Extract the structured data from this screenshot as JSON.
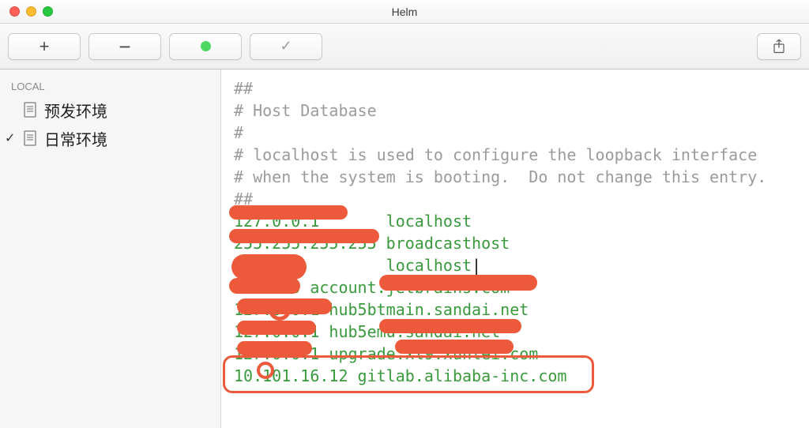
{
  "window": {
    "title": "Helm"
  },
  "toolbar": {
    "add_label": "+",
    "remove_label": "−",
    "check_label": "✓"
  },
  "sidebar": {
    "section_label": "LOCAL",
    "items": [
      {
        "label": "预发环境",
        "selected": false
      },
      {
        "label": "日常环境",
        "selected": true
      }
    ]
  },
  "editor": {
    "lines": [
      {
        "text": "##",
        "cls": "comment"
      },
      {
        "text": "# Host Database",
        "cls": "comment"
      },
      {
        "text": "#",
        "cls": "comment"
      },
      {
        "text": "# localhost is used to configure the loopback interface",
        "cls": "comment"
      },
      {
        "text": "# when the system is booting.  Do not change this entry.",
        "cls": "comment"
      },
      {
        "text": "##",
        "cls": "comment"
      },
      {
        "text": "127.0.0.1       localhost",
        "cls": "ip-green"
      },
      {
        "text": "255.255.255.255 broadcasthost",
        "cls": "ip-green"
      },
      {
        "text": "::1             localhost",
        "cls": "ip-green cursor-line"
      },
      {
        "text": "0.0.0.0 account.jetbrains.com",
        "cls": "ip-green"
      },
      {
        "text": "127.0.0.1 hub5btmain.sandai.net",
        "cls": "ip-green"
      },
      {
        "text": "127.0.0.1 hub5emu.sandai.net",
        "cls": "ip-green"
      },
      {
        "text": "127.0.0.1 upgrade.xl9.xunlei.com",
        "cls": "ip-green"
      },
      {
        "text": "10.101.16.12 gitlab.alibaba-inc.com",
        "cls": "ip-green"
      }
    ]
  }
}
